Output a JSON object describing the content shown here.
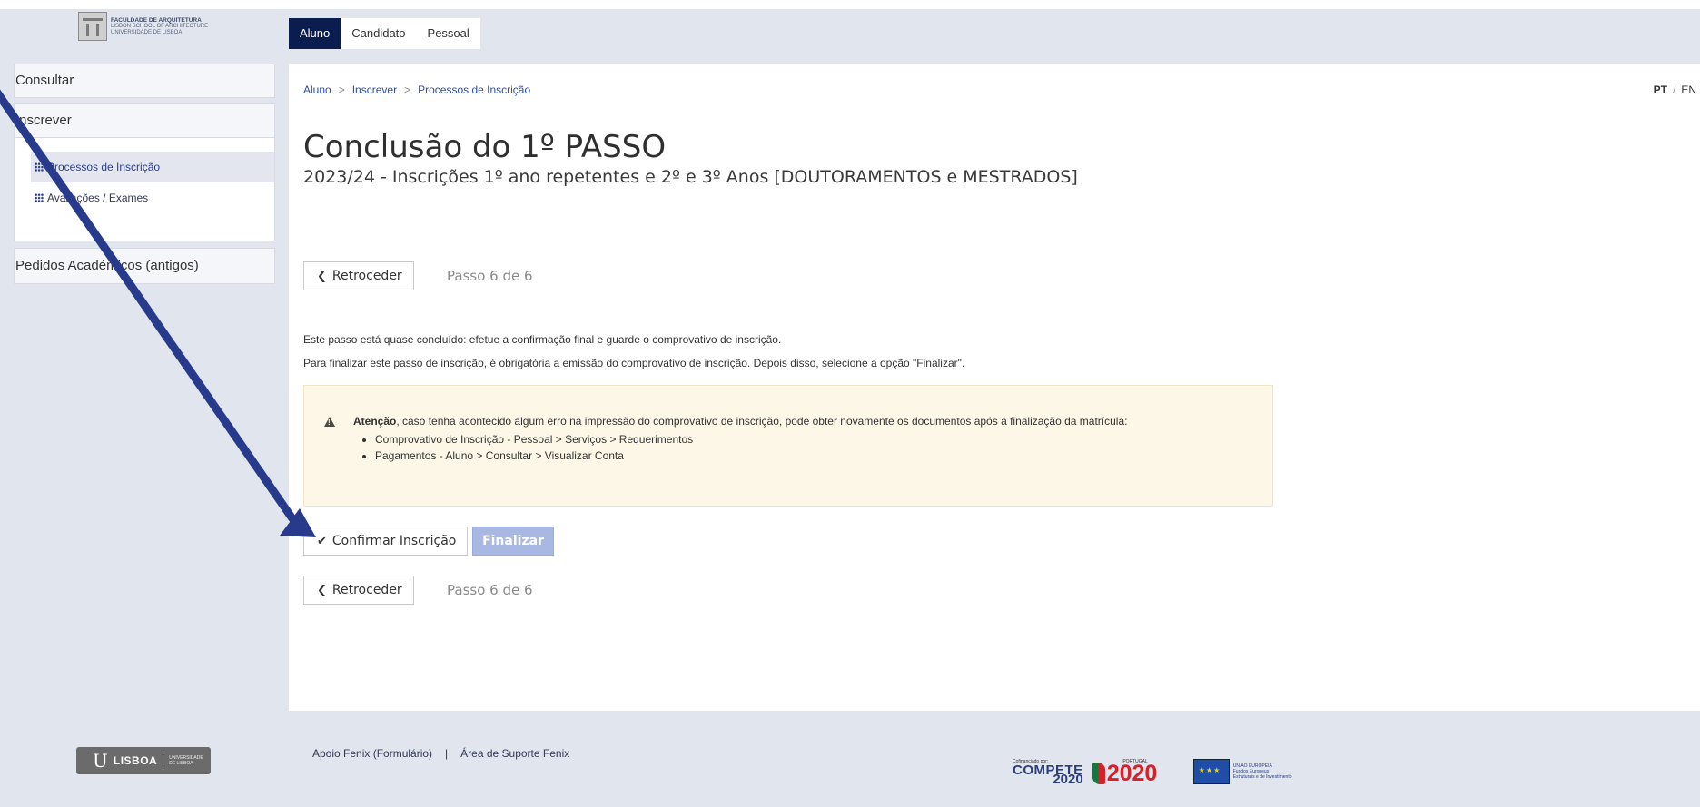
{
  "brand": {
    "logo_line1": "FACULDADE DE ARQUITETURA",
    "logo_line2": "LISBON SCHOOL OF ARCHITECTURE",
    "logo_line3": "UNIVERSIDADE DE LISBOA"
  },
  "tabs": [
    {
      "label": "Aluno",
      "active": true
    },
    {
      "label": "Candidato",
      "active": false
    },
    {
      "label": "Pessoal",
      "active": false
    }
  ],
  "sidebar": {
    "consultar": "Consultar",
    "inscrever": "Inscrever",
    "items": [
      {
        "label": "Processos de Inscrição",
        "active": true
      },
      {
        "label": "Avaliações / Exames",
        "active": false
      }
    ],
    "antigos": "Pedidos Académicos (antigos)"
  },
  "breadcrumb": {
    "items": [
      "Aluno",
      "Inscrever",
      "Processos de Inscrição"
    ],
    "sep": ">"
  },
  "lang": {
    "pt": "PT",
    "sep": "/",
    "en": "EN"
  },
  "page": {
    "title": "Conclusão do 1º PASSO",
    "subtitle": "2023/24 - Inscrições 1º ano repetentes e 2º e 3º Anos [DOUTORAMENTOS e MESTRADOS]"
  },
  "nav": {
    "back_label": "Retroceder",
    "step_label": "Passo 6 de 6"
  },
  "text": {
    "p1": "Este passo está quase concluído: efetue a confirmação final e guarde o comprovativo de inscrição.",
    "p2": "Para finalizar este passo de inscrição, é obrigatória a emissão do comprovativo de inscrição. Depois disso, selecione a opção \"Finalizar\"."
  },
  "warning": {
    "strong": "Atenção",
    "message": ", caso tenha acontecido algum erro na impressão do comprovativo de inscrição, pode obter novamente os documentos após a finalização da matrícula:",
    "bullets": [
      "Comprovativo de Inscrição - Pessoal > Serviços > Requerimentos",
      "Pagamentos - Aluno > Consultar > Visualizar Conta"
    ]
  },
  "actions": {
    "confirm_label": "Confirmar Inscrição",
    "finalize_label": "Finalizar"
  },
  "footer": {
    "ul_logo": "LISBOA",
    "ul_small1": "UNIVERSIDADE",
    "ul_small2": "DE LISBOA",
    "link1": "Apoio Fenix (Formulário)",
    "sep": "|",
    "link2": "Área de Suporte Fenix",
    "cofin": "Cofinanciado por:",
    "compete1": "COMPETE",
    "compete2": "2020",
    "pt_small": "PORTUGAL",
    "pt_year": "2020",
    "eu_line1": "UNIÃO EUROPEIA",
    "eu_line2": "Fundos Europeus",
    "eu_line3": "Estruturais e de Investimento"
  },
  "colors": {
    "nav_dark": "#0b1d4e",
    "link": "#2d4fa1",
    "arrow": "#283a8c",
    "warning_bg": "#fcf7e6",
    "finalize_bg": "#a9b8e2"
  },
  "icons": {
    "back": "chevron-left-icon",
    "confirm": "check-icon",
    "warning": "warning-triangle-icon",
    "grid": "grid-icon"
  }
}
